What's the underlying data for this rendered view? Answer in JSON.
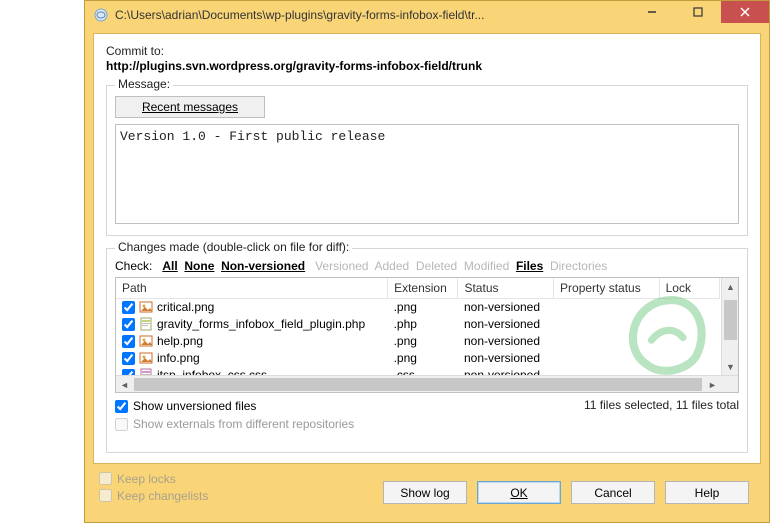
{
  "window": {
    "title": "C:\\Users\\adrian\\Documents\\wp-plugins\\gravity-forms-infobox-field\\tr..."
  },
  "commit": {
    "label": "Commit to:",
    "url": "http://plugins.svn.wordpress.org/gravity-forms-infobox-field/trunk"
  },
  "message_group": {
    "legend": "Message:",
    "recent_button": "Recent messages",
    "text": "Version 1.0 - First public release"
  },
  "changes": {
    "legend": "Changes made (double-click on file for diff):",
    "check_label": "Check:",
    "filters": {
      "all": "All",
      "none": "None",
      "nonversioned": "Non-versioned",
      "versioned": "Versioned",
      "added": "Added",
      "deleted": "Deleted",
      "modified": "Modified",
      "files": "Files",
      "directories": "Directories"
    },
    "columns": {
      "path": "Path",
      "extension": "Extension",
      "status": "Status",
      "propstatus": "Property status",
      "lock": "Lock"
    },
    "rows": [
      {
        "checked": true,
        "name": "critical.png",
        "ext": ".png",
        "status": "non-versioned",
        "icon": "image"
      },
      {
        "checked": true,
        "name": "gravity_forms_infobox_field_plugin.php",
        "ext": ".php",
        "status": "non-versioned",
        "icon": "php"
      },
      {
        "checked": true,
        "name": "help.png",
        "ext": ".png",
        "status": "non-versioned",
        "icon": "image"
      },
      {
        "checked": true,
        "name": "info.png",
        "ext": ".png",
        "status": "non-versioned",
        "icon": "image"
      },
      {
        "checked": true,
        "name": "itsp_infobox_css.css",
        "ext": ".css",
        "status": "non-versioned",
        "icon": "css"
      }
    ],
    "show_unversioned": {
      "label": "Show unversioned files",
      "checked": true
    },
    "show_externals": {
      "label": "Show externals from different repositories",
      "checked": false,
      "disabled": true
    },
    "status": "11 files selected, 11 files total"
  },
  "lower": {
    "keep_locks": {
      "label": "Keep locks",
      "checked": false
    },
    "keep_changelists": {
      "label": "Keep changelists",
      "checked": false
    },
    "buttons": {
      "showlog": "Show log",
      "ok": "OK",
      "cancel": "Cancel",
      "help": "Help"
    }
  }
}
